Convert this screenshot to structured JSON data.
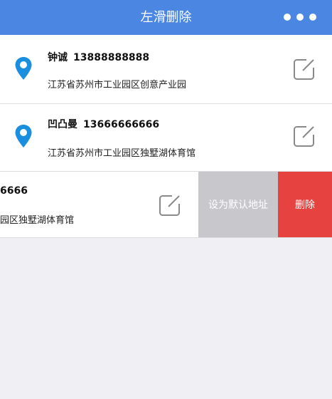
{
  "header": {
    "title": "左滑删除",
    "more_icon": "more-dots-icon"
  },
  "colors": {
    "header_bg": "#4b86e3",
    "pin": "#1a8fe0",
    "set_default_bg": "#c8c7cc",
    "delete_bg": "#e64340",
    "page_bg": "#efeff4"
  },
  "addresses": [
    {
      "name": "钟诚",
      "phone": "13888888888",
      "address": "江苏省苏州市工业园区创意产业园"
    },
    {
      "name": "凹凸曼",
      "phone": "13666666666",
      "address": "江苏省苏州市工业园区独墅湖体育馆"
    },
    {
      "name": "6666",
      "phone": "",
      "address": "园区独墅湖体育馆"
    }
  ],
  "actions": {
    "set_default_label": "设为默认地址",
    "delete_label": "删除"
  },
  "icons": {
    "location": "location-pin-icon",
    "edit": "edit-icon"
  }
}
